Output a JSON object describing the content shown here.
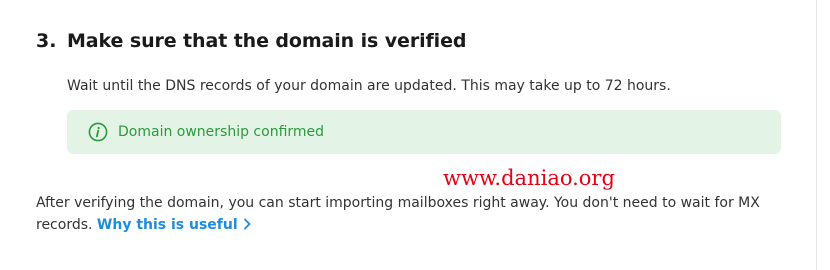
{
  "step": {
    "number": "3.",
    "title": "Make sure that the domain is verified",
    "description": "Wait until the DNS records of your domain are updated. This may take up to 72 hours."
  },
  "status": {
    "icon": "info-circle-icon",
    "text": "Domain ownership confirmed",
    "color": "#2b9a3b",
    "background": "#e3f4e6"
  },
  "watermark": {
    "text": "www.daniao.org",
    "color": "#e60012"
  },
  "info": {
    "text": "After verifying the domain, you can start importing mailboxes right away. You don't need to wait for MX records.",
    "link_label": "Why this is useful",
    "link_icon": "chevron-right-icon",
    "link_color": "#1c8de0"
  }
}
